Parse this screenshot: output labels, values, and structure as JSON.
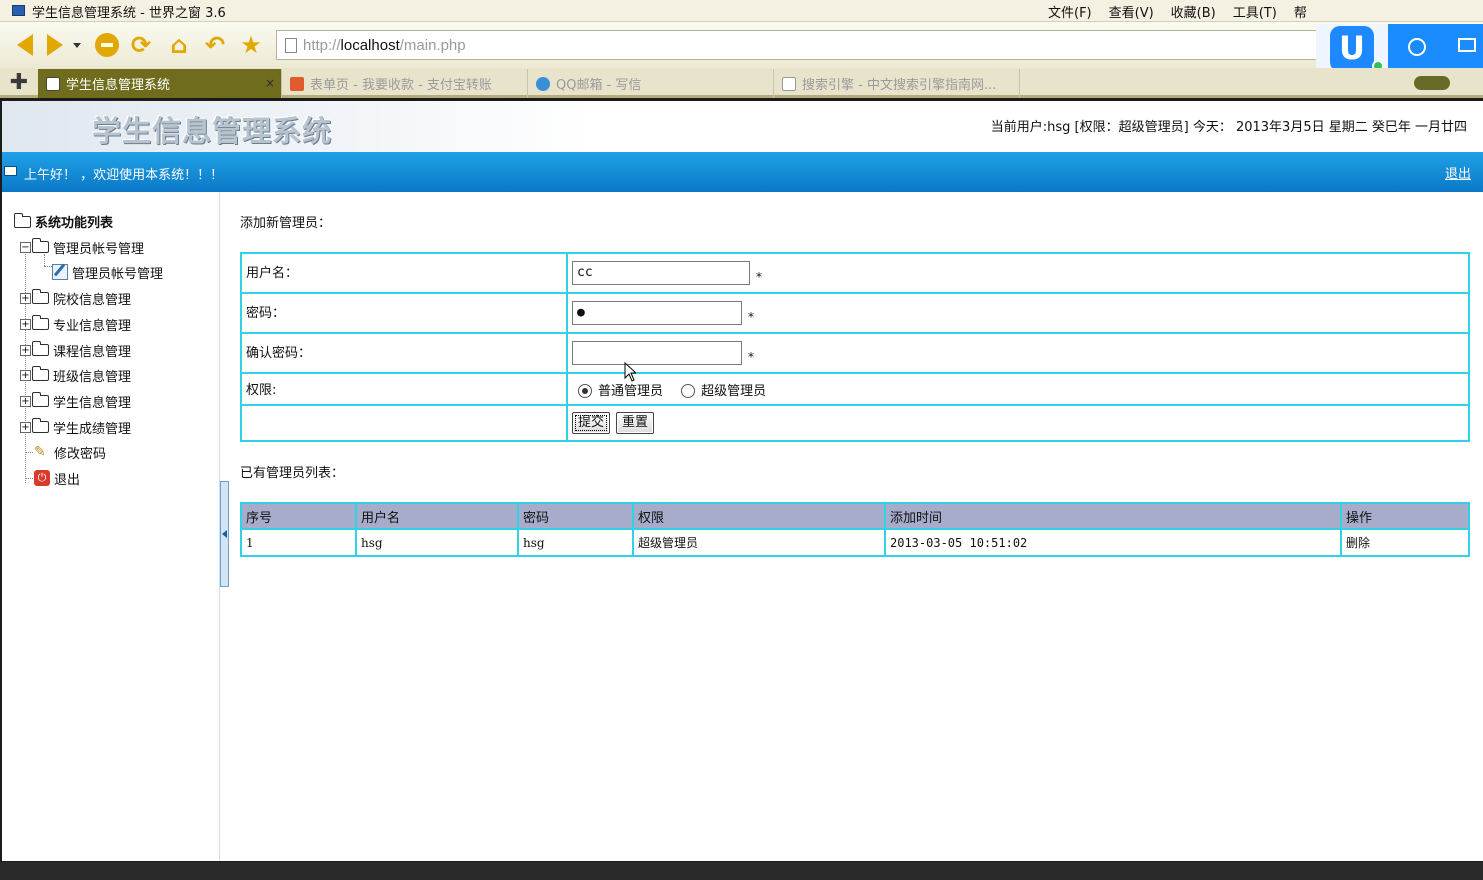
{
  "browser": {
    "window_title": "学生信息管理系统 - 世界之窗 3.6",
    "menus": [
      "文件(F)",
      "查看(V)",
      "收藏(B)",
      "工具(T)",
      "帮"
    ],
    "url_proto": "http://",
    "url_host": "localhost",
    "url_path": "/main.php",
    "tabs": [
      {
        "label": "学生信息管理系统",
        "close": "×",
        "active": true
      },
      {
        "label": "表单页 - 我要收款 - 支付宝转账",
        "active": false
      },
      {
        "label": "QQ邮箱 - 写信",
        "active": false
      },
      {
        "label": "搜索引擎 - 中文搜索引擎指南网...",
        "active": false
      }
    ],
    "new_tab": "✚"
  },
  "header": {
    "logo": "学生信息管理系统",
    "userinfo": "当前用户:hsg [权限：超级管理员] 今天： 2013年3月5日 星期二 癸巳年 一月廿四"
  },
  "bluebar": {
    "welcome": "上午好！ ，欢迎使用本系统！！！",
    "logout": "退出"
  },
  "sidebar": {
    "root": "系统功能列表",
    "items": [
      {
        "label": "管理员帐号管理",
        "expander": "−"
      },
      {
        "label": "管理员帐号管理"
      },
      {
        "label": "院校信息管理",
        "expander": "+"
      },
      {
        "label": "专业信息管理",
        "expander": "+"
      },
      {
        "label": "课程信息管理",
        "expander": "+"
      },
      {
        "label": "班级信息管理",
        "expander": "+"
      },
      {
        "label": "学生信息管理",
        "expander": "+"
      },
      {
        "label": "学生成绩管理",
        "expander": "+"
      },
      {
        "label": "修改密码"
      },
      {
        "label": "退出"
      }
    ]
  },
  "form": {
    "title": "添加新管理员：",
    "username_label": "用户名：",
    "username_value": "cc",
    "password_label": "密码：",
    "password_value": "●",
    "confirm_label": "确认密码：",
    "confirm_value": "",
    "required_mark": "*",
    "role_label": "权限:",
    "role_options": [
      "普通管理员",
      "超级管理员"
    ],
    "role_selected": "普通管理员",
    "submit": "提交",
    "reset": "重置"
  },
  "list": {
    "title": "已有管理员列表：",
    "columns": [
      "序号",
      "用户名",
      "密码",
      "权限",
      "添加时间",
      "操作"
    ],
    "rows": [
      [
        "1",
        "hsg",
        "hsg",
        "超级管理员",
        "2013-03-05 10:51:02",
        "删除"
      ]
    ]
  }
}
